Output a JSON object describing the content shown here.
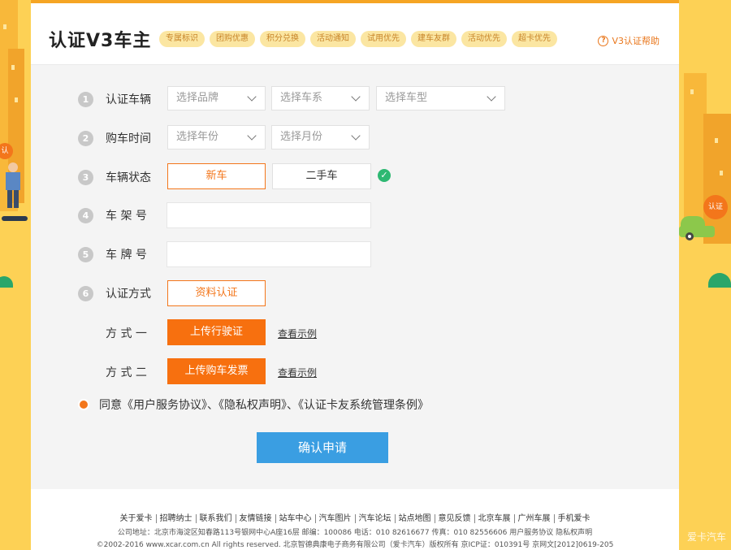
{
  "header": {
    "title": "认证V3车主",
    "perks": [
      "专属标识",
      "团购优惠",
      "积分兑换",
      "活动通知",
      "试用优先",
      "建车友群",
      "活动优先",
      "超卡优先"
    ],
    "help_label": "V3认证帮助",
    "help_icon": "?"
  },
  "form": {
    "vehicle": {
      "step": "1",
      "label": "认证车辆",
      "brand_placeholder": "选择品牌",
      "series_placeholder": "选择车系",
      "model_placeholder": "选择车型"
    },
    "purchase_time": {
      "step": "2",
      "label": "购车时间",
      "year_placeholder": "选择年份",
      "month_placeholder": "选择月份"
    },
    "vehicle_status": {
      "step": "3",
      "label": "车辆状态",
      "options": [
        "新车",
        "二手车"
      ],
      "selected": "新车",
      "check_icon": "✓"
    },
    "vin": {
      "step": "4",
      "label": "车 架 号",
      "value": ""
    },
    "plate": {
      "step": "5",
      "label": "车 牌 号",
      "value": ""
    },
    "method": {
      "step": "6",
      "label": "认证方式",
      "option": "资料认证",
      "way1": {
        "label": "方 式 一",
        "button": "上传行驶证",
        "link": "查看示例"
      },
      "way2": {
        "label": "方 式 二",
        "button": "上传购车发票",
        "link": "查看示例"
      }
    },
    "agreement": "同意《用户服务协议》、《隐私权声明》、《认证卡友系统管理条例》",
    "submit": "确认申请"
  },
  "footer": {
    "links": [
      "关于爱卡",
      "招聘纳士",
      "联系我们",
      "友情链接",
      "站车中心",
      "汽车图片",
      "汽车论坛",
      "站点地图",
      "意见反馈",
      "北京车展",
      "广州车展",
      "手机爱卡"
    ],
    "line1": "公司地址：北京市海淀区知春路113号银网中心A座16层 邮编：100086 电话：010 82616677 传真：010 82556606 用户服务协议 隐私权声明",
    "line2": "©2002-2016 www.xcar.com.cn All rights reserved. 北京智德典康电子商务有限公司（爱卡汽车）版权所有 京ICP证：010391号 京网文[2012]0619-205"
  },
  "decor": {
    "left_bubble": "认",
    "right_bubble": "认证",
    "watermark": "爱卡汽车"
  },
  "colors": {
    "accent": "#f3761b",
    "primary": "#3a9ee2",
    "background": "#fdd155",
    "success": "#2eb872"
  }
}
